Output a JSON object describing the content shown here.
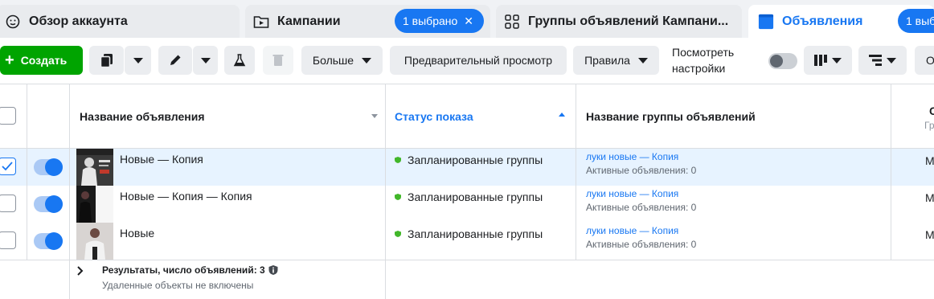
{
  "tabs": [
    {
      "label": "Обзор аккаунта",
      "icon": "account-overview-icon"
    },
    {
      "label": "Кампании",
      "icon": "campaign-folder-icon",
      "badge": "1 выбрано",
      "badge_close": "✕"
    },
    {
      "label": "Группы объявлений Кампани...",
      "icon": "ad-sets-grid-icon"
    },
    {
      "label": "Объявления",
      "icon": "ads-icon",
      "badge": "1 выб"
    }
  ],
  "toolbar": {
    "create_label": "Создать",
    "more_label": "Больше",
    "preview_label": "Предварительный просмотр",
    "rules_label": "Правила",
    "preview_settings_line1": "Посмотреть",
    "preview_settings_line2": "настройки",
    "truncated_right": "О"
  },
  "table": {
    "columns": [
      {
        "label": "Название объявления",
        "sorted": false
      },
      {
        "label": "Статус показа",
        "sorted": true,
        "direction": "asc"
      },
      {
        "label": "Название группы объявлений",
        "sorted": false
      },
      {
        "label": "С",
        "sublabel": "Гр"
      }
    ],
    "rows": [
      {
        "name": "Новые — Копия",
        "status": "Запланированные группы",
        "adset": "луки новые — Копия",
        "adset_sub": "Активные объявления: 0",
        "trunc": "M",
        "selected": true,
        "checked": true
      },
      {
        "name": "Новые — Копия — Копия",
        "status": "Запланированные группы",
        "adset": "луки новые — Копия",
        "adset_sub": "Активные объявления: 0",
        "trunc": "M",
        "selected": false,
        "checked": false
      },
      {
        "name": "Новые",
        "status": "Запланированные группы",
        "adset": "луки новые — Копия",
        "adset_sub": "Активные объявления: 0",
        "trunc": "M",
        "selected": false,
        "checked": false
      }
    ],
    "footer": {
      "title": "Результаты, число объявлений: 3",
      "subtitle": "Удаленные объекты не включены"
    }
  },
  "colors": {
    "accent": "#1877f2",
    "create_green": "#00a400",
    "status_green": "#42b72a",
    "selected_row": "#e7f3ff"
  }
}
